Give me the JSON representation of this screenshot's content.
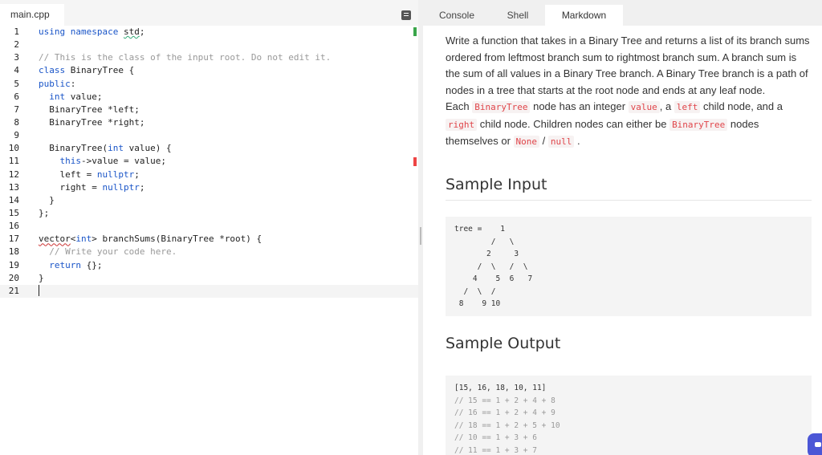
{
  "editor": {
    "file_tab": "main.cpp",
    "lines": [
      {
        "n": "1",
        "html": "<span class=\"kw\">using namespace</span> <span class=\"sq\">std</span>;"
      },
      {
        "n": "2",
        "html": ""
      },
      {
        "n": "3",
        "html": "<span class=\"cm\">// This is the class of the input root. Do not edit it.</span>"
      },
      {
        "n": "4",
        "html": "<span class=\"kw\">class</span> BinaryTree {"
      },
      {
        "n": "5",
        "html": "<span class=\"kw\">public</span>:"
      },
      {
        "n": "6",
        "html": "  <span class=\"kw\">int</span> value;"
      },
      {
        "n": "7",
        "html": "  BinaryTree *left;"
      },
      {
        "n": "8",
        "html": "  BinaryTree *right;"
      },
      {
        "n": "9",
        "html": ""
      },
      {
        "n": "10",
        "html": "  BinaryTree(<span class=\"kw\">int</span> value) {"
      },
      {
        "n": "11",
        "html": "    <span class=\"kw\">this</span>-&gt;value = value;"
      },
      {
        "n": "12",
        "html": "    left = <span class=\"kw\">nullptr</span>;"
      },
      {
        "n": "13",
        "html": "    right = <span class=\"kw\">nullptr</span>;"
      },
      {
        "n": "14",
        "html": "  }"
      },
      {
        "n": "15",
        "html": "};"
      },
      {
        "n": "16",
        "html": ""
      },
      {
        "n": "17",
        "html": "<span class=\"sqr\">vector</span>&lt;<span class=\"kw\">int</span>&gt; branchSums(BinaryTree *root) {"
      },
      {
        "n": "18",
        "html": "  <span class=\"cm\">// Write your code here.</span>"
      },
      {
        "n": "19",
        "html": "  <span class=\"kw\">return</span> {};"
      },
      {
        "n": "20",
        "html": "}"
      },
      {
        "n": "21",
        "html": "<span class=\"cursor\"></span>"
      }
    ]
  },
  "tabs": {
    "console": "Console",
    "shell": "Shell",
    "markdown": "Markdown"
  },
  "prompt": {
    "p1": "Write a function that takes in a Binary Tree and returns a list of its branch sums ordered from leftmost branch sum to rightmost branch sum. A branch sum is the sum of all values in a Binary Tree branch. A Binary Tree branch is a path of nodes in a tree that starts at the root node and ends at any leaf node.",
    "p2_parts": [
      "Each ",
      "BinaryTree",
      " node has an integer ",
      "value",
      ", a ",
      "left",
      " child node, and a ",
      "right",
      " child node. Children nodes can either be ",
      "BinaryTree",
      " nodes themselves or ",
      "None",
      " / ",
      "null",
      " ."
    ],
    "sample_input_heading": "Sample Input",
    "sample_output_heading": "Sample Output",
    "sample_input": "tree =    1\n        /   \\\n       2     3\n     /  \\   /  \\\n    4    5  6   7\n  /  \\  /\n 8    9 10",
    "sample_output_main": "[15, 16, 18, 10, 11]",
    "sample_output_comments": [
      "// 15 == 1 + 2 + 4 + 8",
      "// 16 == 1 + 2 + 4 + 9",
      "// 18 == 1 + 2 + 5 + 10",
      "// 10 == 1 + 3 + 6",
      "// 11 == 1 + 3 + 7"
    ]
  }
}
